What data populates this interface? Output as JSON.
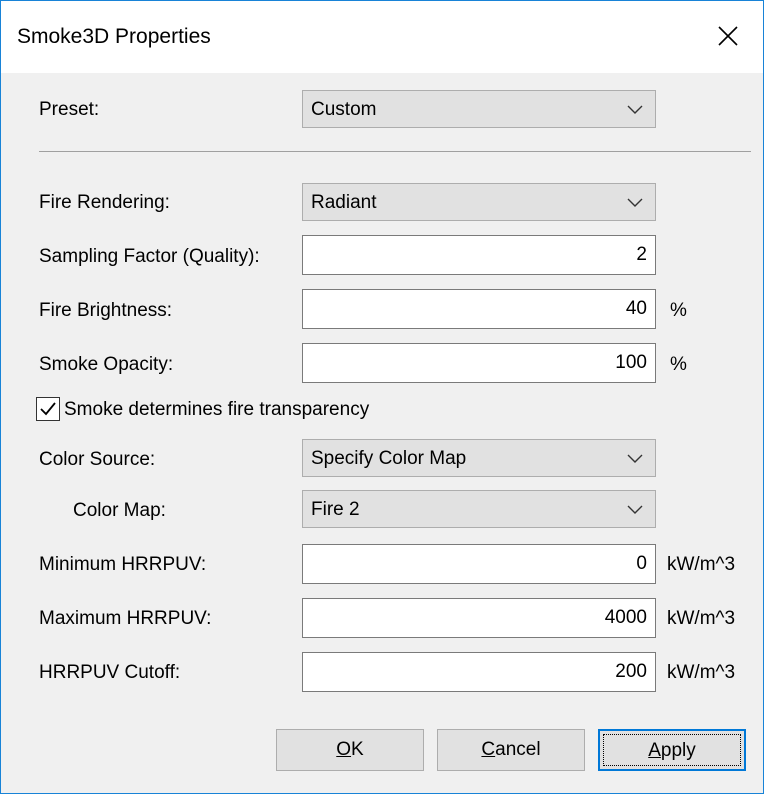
{
  "window": {
    "title": "Smoke3D Properties"
  },
  "preset": {
    "label": "Preset:",
    "value": "Custom"
  },
  "fire_rendering": {
    "label": "Fire Rendering:",
    "value": "Radiant"
  },
  "sampling_factor": {
    "label": "Sampling Factor (Quality):",
    "value": "2"
  },
  "fire_brightness": {
    "label": "Fire Brightness:",
    "value": "40",
    "unit": "%"
  },
  "smoke_opacity": {
    "label": "Smoke Opacity:",
    "value": "100",
    "unit": "%"
  },
  "smoke_transparency": {
    "label": "Smoke determines fire transparency",
    "checked": true
  },
  "color_source": {
    "label": "Color Source:",
    "value": "Specify Color Map"
  },
  "color_map": {
    "label": "Color Map:",
    "value": "Fire 2"
  },
  "min_hrrpuv": {
    "label": "Minimum HRRPUV:",
    "value": "0",
    "unit": "kW/m^3"
  },
  "max_hrrpuv": {
    "label": "Maximum HRRPUV:",
    "value": "4000",
    "unit": "kW/m^3"
  },
  "hrrpuv_cutoff": {
    "label": "HRRPUV Cutoff:",
    "value": "200",
    "unit": "kW/m^3"
  },
  "buttons": {
    "ok": {
      "mnemonic": "O",
      "rest": "K"
    },
    "cancel": {
      "mnemonic": "C",
      "rest": "ancel"
    },
    "apply": {
      "mnemonic": "A",
      "rest": "pply"
    }
  },
  "colors": {
    "accent": "#0078d7",
    "window_border": "#1883d7"
  },
  "icons": {
    "close": "close-icon",
    "dropdown": "chevron-down-icon",
    "checkbox": "checkmark-icon"
  }
}
